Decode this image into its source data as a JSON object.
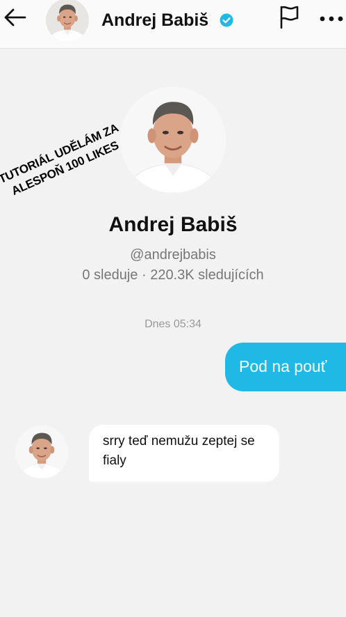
{
  "header": {
    "name": "Andrej Babiš",
    "back_icon": "arrow-left-icon",
    "verified_icon": "verified-badge-icon",
    "report_icon": "flag-icon",
    "more_icon": "more-horizontal-icon"
  },
  "profile": {
    "name": "Andrej Babiš",
    "handle": "@andrejbabis",
    "stats": "0 sleduje · 220.3K sledujících"
  },
  "overlay": {
    "line1": "TUTORIÁL UDĚLÁM ZA",
    "line2": "ALESPOŇ 100 LIKES"
  },
  "chat": {
    "timestamp": "Dnes 05:34",
    "messages": [
      {
        "direction": "sent",
        "text": "Pod na pouť"
      },
      {
        "direction": "received",
        "text": "srry teď nemužu zeptej se fialy"
      }
    ]
  },
  "colors": {
    "accent": "#20b8e4",
    "verified": "#20b8e4",
    "background": "#f2f2f2"
  }
}
